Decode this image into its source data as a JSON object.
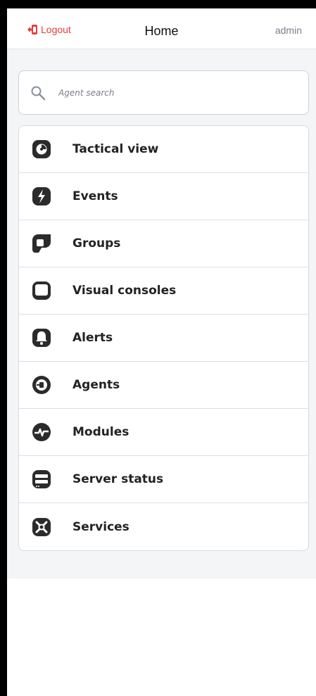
{
  "header": {
    "logout_label": "Logout",
    "title": "Home",
    "user": "admin"
  },
  "search": {
    "placeholder": "Agent search"
  },
  "menu": {
    "items": [
      {
        "label": "Tactical view",
        "icon": "tactical-view-icon"
      },
      {
        "label": "Events",
        "icon": "events-icon"
      },
      {
        "label": "Groups",
        "icon": "groups-icon"
      },
      {
        "label": "Visual consoles",
        "icon": "visual-consoles-icon"
      },
      {
        "label": "Alerts",
        "icon": "alerts-icon"
      },
      {
        "label": "Agents",
        "icon": "agents-icon"
      },
      {
        "label": "Modules",
        "icon": "modules-icon"
      },
      {
        "label": "Server status",
        "icon": "server-status-icon"
      },
      {
        "label": "Services",
        "icon": "services-icon"
      }
    ]
  },
  "colors": {
    "accent": "#e63c3c",
    "icon": "#2b2b2b",
    "background": "#f4f5f7"
  }
}
